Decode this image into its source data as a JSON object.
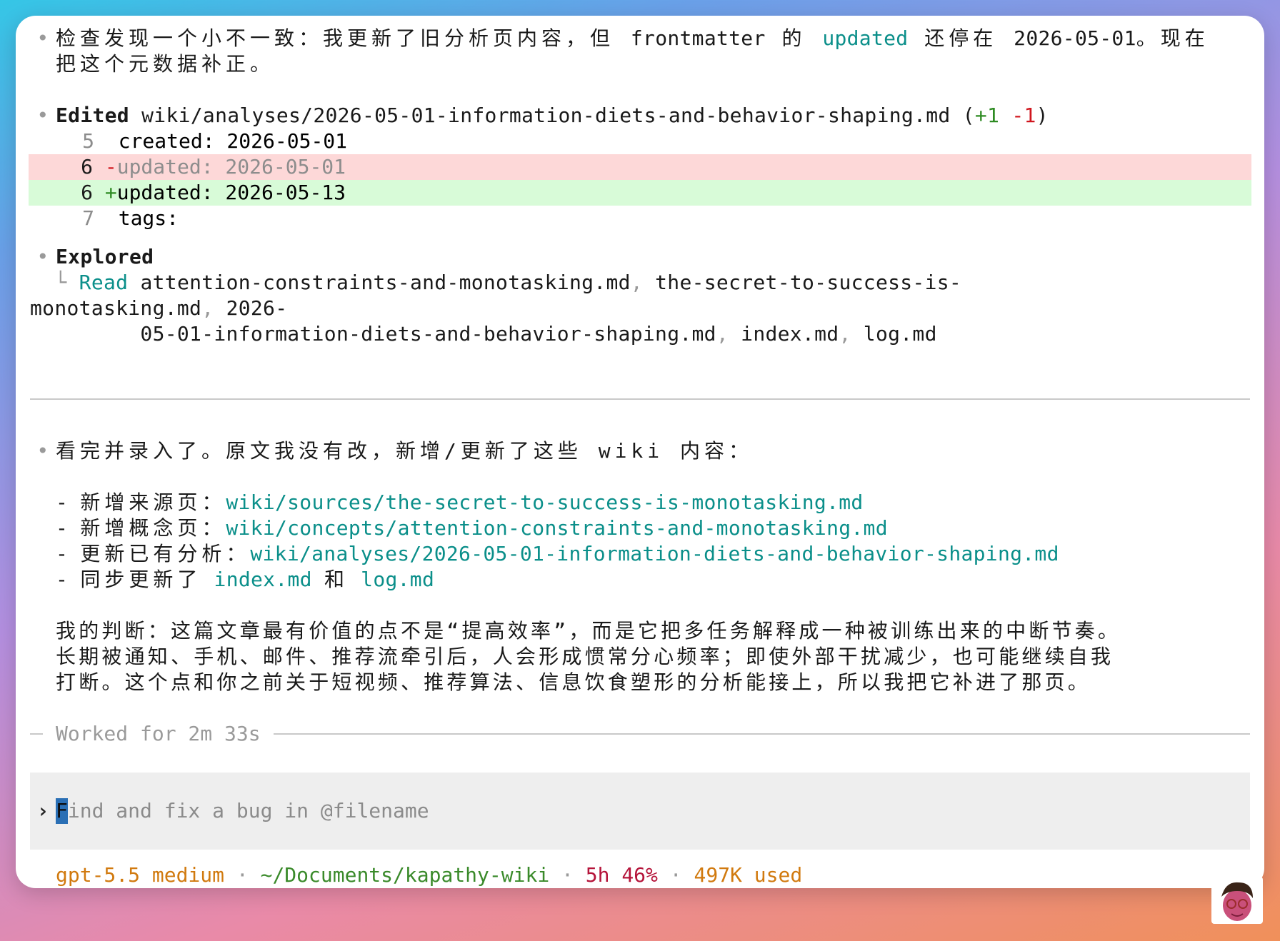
{
  "msg1": {
    "line1_a": "检查发现一个小不一致：我更新了旧分析页内容，但 ",
    "line1_b": "frontmatter",
    "line1_c": " 的 ",
    "line1_d": "updated",
    "line1_e": " 还停在 ",
    "line1_f": "2026-05-01",
    "line1_g": "。现在",
    "line2": "把这个元数据补正。"
  },
  "edit": {
    "label": "Edited",
    "path": "wiki/analyses/2026-05-01-information-diets-and-behavior-shaping.md",
    "open": " (",
    "plus": "+1",
    "minus": "-1",
    "close": ")",
    "rows": [
      {
        "num": "5",
        "sign": "",
        "text": "created: 2026-05-01"
      },
      {
        "num": "6",
        "sign": "-",
        "text": "updated: 2026-05-01"
      },
      {
        "num": "6",
        "sign": "+",
        "text": "updated: 2026-05-13"
      },
      {
        "num": "7",
        "sign": "",
        "text": "tags:"
      }
    ]
  },
  "explored": {
    "label": "Explored",
    "tree": "└",
    "read": "Read",
    "l1": "attention-constraints-and-monotasking.md",
    "comma": ",",
    "l1b": "the-secret-to-success-is-",
    "l2": "monotasking.md",
    "l2b": "2026-",
    "l3": "05-01-information-diets-and-behavior-shaping.md",
    "l3b": "index.md",
    "l3c": "log.md"
  },
  "msg2": {
    "intro": "看完并录入了。原文我没有改，新增/更新了这些 wiki 内容：",
    "items": [
      {
        "dash": "-",
        "label": "新增来源页：",
        "link": "wiki/sources/the-secret-to-success-is-monotasking.md"
      },
      {
        "dash": "-",
        "label": "新增概念页：",
        "link": "wiki/concepts/attention-constraints-and-monotasking.md"
      },
      {
        "dash": "-",
        "label": "更新已有分析：",
        "link": "wiki/analyses/2026-05-01-information-diets-and-behavior-shaping.md"
      }
    ],
    "sync_label": "同步更新了",
    "sync_link1": "index.md",
    "sync_and": "和",
    "sync_link2": "log.md",
    "judge_l1": "我的判断：这篇文章最有价值的点不是“提高效率”，而是它把多任务解释成一种被训练出来的中断节奏。",
    "judge_l2": "长期被通知、手机、邮件、推荐流牵引后，人会形成惯常分心频率；即使外部干扰减少，也可能继续自我",
    "judge_l3": "打断。这个点和你之前关于短视频、推荐算法、信息饮食塑形的分析能接上，所以我把它补进了那页。"
  },
  "worked": "Worked for 2m 33s",
  "prompt": {
    "caret": "›",
    "first_char": "F",
    "placeholder_rest": "ind and fix a bug in @filename"
  },
  "status": {
    "model": "gpt-5.5 medium",
    "dot": "·",
    "path": "~/Documents/kapathy-wiki",
    "usage": "5h 46%",
    "tokens": "497K used"
  },
  "colors": {
    "accent_teal": "#0b8f8a",
    "diff_add_bg": "#d8fbd8",
    "diff_del_bg": "#fdd8d8",
    "added_count": "#2e8b22",
    "removed_count": "#d0161e",
    "status_model": "#d17a0f",
    "status_path": "#3a8a2a",
    "status_usage": "#b5143a"
  }
}
